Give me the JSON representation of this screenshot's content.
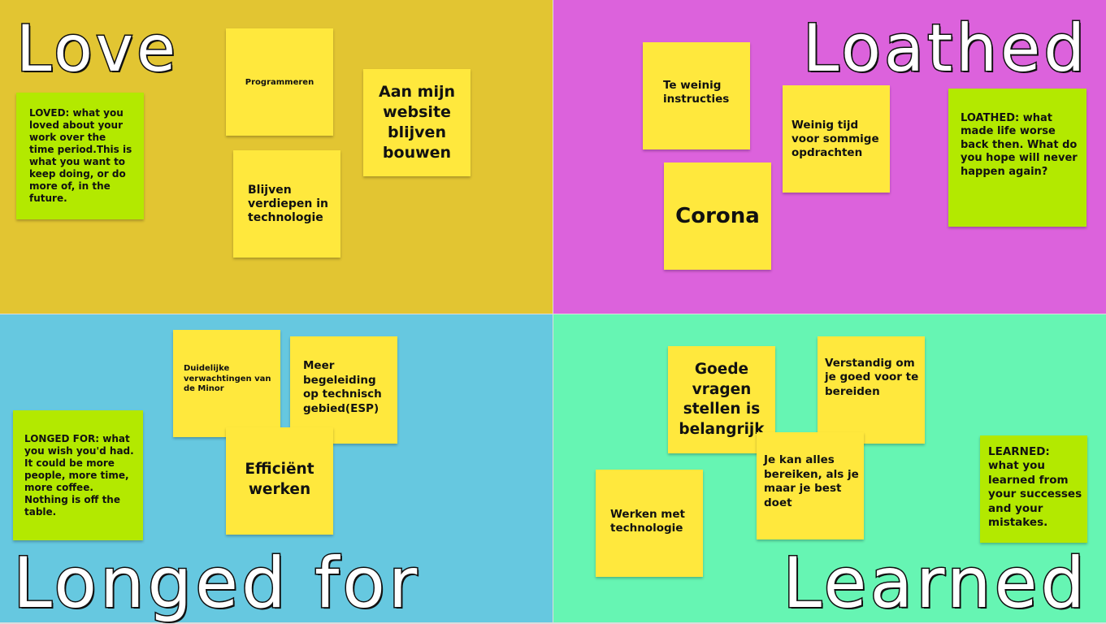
{
  "colors": {
    "love_bg": "#e2c532",
    "loathed_bg": "#dc62dc",
    "longed_bg": "#66c8e0",
    "learned_bg": "#66f5b3",
    "sticky_yellow": "#ffe83d",
    "sticky_green": "#b3e900"
  },
  "love": {
    "title": "Love",
    "description": "LOVED: what you loved about your work over the time period.This is what you want to keep doing, or do more of, in the future.",
    "notes": [
      "Programmeren",
      "Blijven verdiepen in technologie",
      "Aan mijn website blijven bouwen"
    ]
  },
  "loathed": {
    "title": "Loathed",
    "description": "LOATHED: what made life worse back then. What do you hope will never happen again?",
    "notes": [
      "Te weinig instructies",
      "Weinig tijd voor sommige opdrachten",
      "Corona"
    ]
  },
  "longed": {
    "title": "Longed for",
    "description": "LONGED FOR: what you wish you'd had. It could be more people, more time, more coffee. Nothing is off the table.",
    "notes": [
      "Duidelijke verwachtingen van de Minor",
      "Meer begeleiding op technisch gebied(ESP)",
      "Efficiënt werken"
    ]
  },
  "learned": {
    "title": "Learned",
    "description": "LEARNED: what you learned from your successes and your mistakes.",
    "notes": [
      "Goede vragen stellen is belangrijk",
      "Verstandig om je goed voor te bereiden",
      "Je kan alles bereiken, als je maar je best doet",
      "Werken met technologie"
    ]
  }
}
